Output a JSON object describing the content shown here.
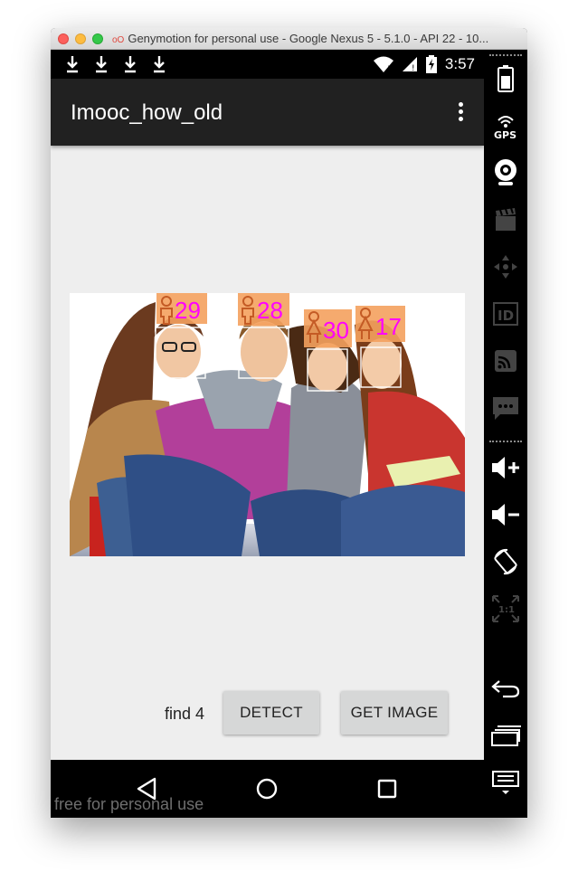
{
  "window": {
    "title": "Genymotion for personal use - Google Nexus 5 - 5.1.0 - API 22 - 10..."
  },
  "status_bar": {
    "time": "3:57",
    "notification_icons": [
      "download-icon",
      "download-icon",
      "download-icon",
      "download-icon"
    ],
    "system_icons": [
      "wifi-icon",
      "signal-icon",
      "battery-charging-icon"
    ]
  },
  "app_bar": {
    "title": "Imooc_how_old",
    "menu_icon": "overflow-menu-icon"
  },
  "image": {
    "description_icon": "detected-faces-photo",
    "faces": [
      {
        "age": "29",
        "gender": "male"
      },
      {
        "age": "28",
        "gender": "male"
      },
      {
        "age": "30",
        "gender": "female"
      },
      {
        "age": "17",
        "gender": "female"
      }
    ],
    "label_color": "#ff00ff",
    "badge_color": "#f4a15e"
  },
  "actions": {
    "find_text": "find 4",
    "detect_label": "DETECT",
    "get_image_label": "GET IMAGE"
  },
  "nav_bar": {
    "back": "back-icon",
    "home": "home-icon",
    "recents": "recents-icon"
  },
  "watermark": "free for personal use",
  "side_panel": {
    "icons": [
      "battery-icon",
      "gps-icon",
      "webcam-icon",
      "screencast-icon",
      "dpad-icon",
      "device-id-icon",
      "cast-icon",
      "sms-icon",
      "volume-up-icon",
      "volume-down-icon",
      "rotate-icon",
      "pixel-perfect-icon",
      "back-icon",
      "recent-apps-icon",
      "menu-icon"
    ],
    "gps_label": "GPS",
    "pixel_label": "1:1"
  }
}
